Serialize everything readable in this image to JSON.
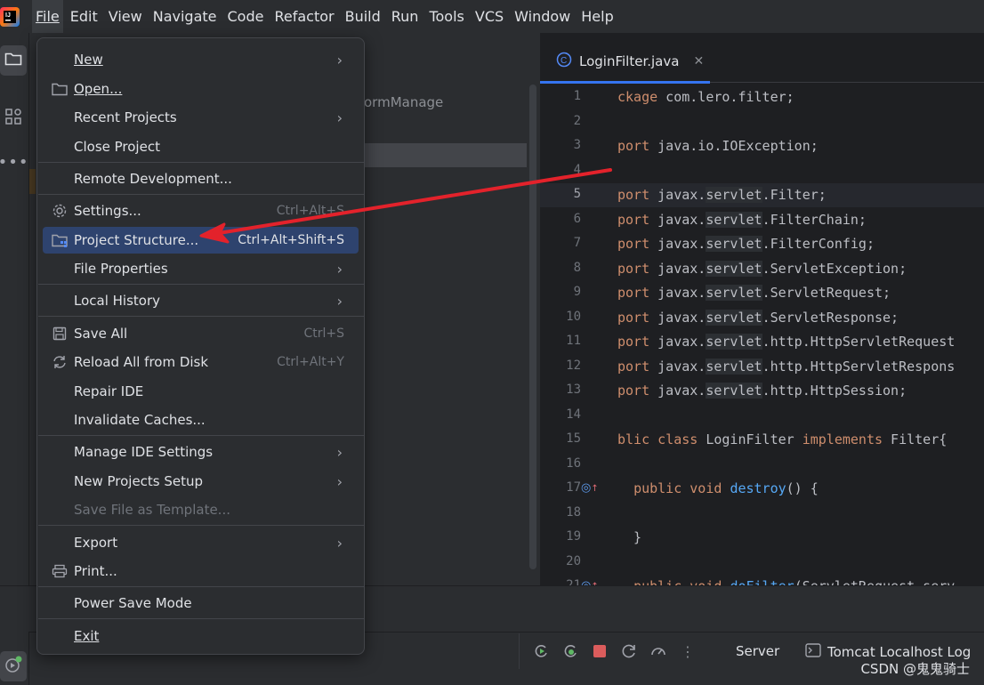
{
  "menubar": {
    "items": [
      {
        "label": "File",
        "active": true
      },
      {
        "label": "Edit"
      },
      {
        "label": "View"
      },
      {
        "label": "Navigate"
      },
      {
        "label": "Code"
      },
      {
        "label": "Refactor"
      },
      {
        "label": "Build"
      },
      {
        "label": "Run"
      },
      {
        "label": "Tools"
      },
      {
        "label": "VCS"
      },
      {
        "label": "Window"
      },
      {
        "label": "Help"
      }
    ]
  },
  "project": {
    "partial_text": "ormManage"
  },
  "editor": {
    "tab_label": "LoginFilter.java",
    "line_numbers": [
      "1",
      "2",
      "3",
      "4",
      "5",
      "6",
      "7",
      "8",
      "9",
      "10",
      "11",
      "12",
      "13",
      "14",
      "15",
      "16",
      "17",
      "18",
      "19",
      "20",
      "21"
    ],
    "current_line": "5"
  },
  "file_menu": {
    "new": "New",
    "open": "Open...",
    "recent_projects": "Recent Projects",
    "close_project": "Close Project",
    "remote_development": "Remote Development...",
    "settings": "Settings...",
    "settings_shortcut": "Ctrl+Alt+S",
    "project_structure": "Project Structure...",
    "project_structure_shortcut": "Ctrl+Alt+Shift+S",
    "file_properties": "File Properties",
    "local_history": "Local History",
    "save_all": "Save All",
    "save_all_shortcut": "Ctrl+S",
    "reload_all": "Reload All from Disk",
    "reload_all_shortcut": "Ctrl+Alt+Y",
    "repair_ide": "Repair IDE",
    "invalidate_caches": "Invalidate Caches...",
    "manage_ide_settings": "Manage IDE Settings",
    "new_projects_setup": "New Projects Setup",
    "save_file_as_template": "Save File as Template...",
    "export": "Export",
    "print": "Print...",
    "power_save_mode": "Power Save Mode",
    "exit": "Exit"
  },
  "bottom": {
    "server_tab": "Server",
    "tomcat_tab": "Tomcat Localhost Log",
    "watermark": "CSDN @鬼鬼骑士"
  },
  "colors": {
    "highlight": "#2e436e",
    "keyword": "#cf8e6d",
    "function": "#56a8f5",
    "annotation_arrow": "#e3222b"
  }
}
